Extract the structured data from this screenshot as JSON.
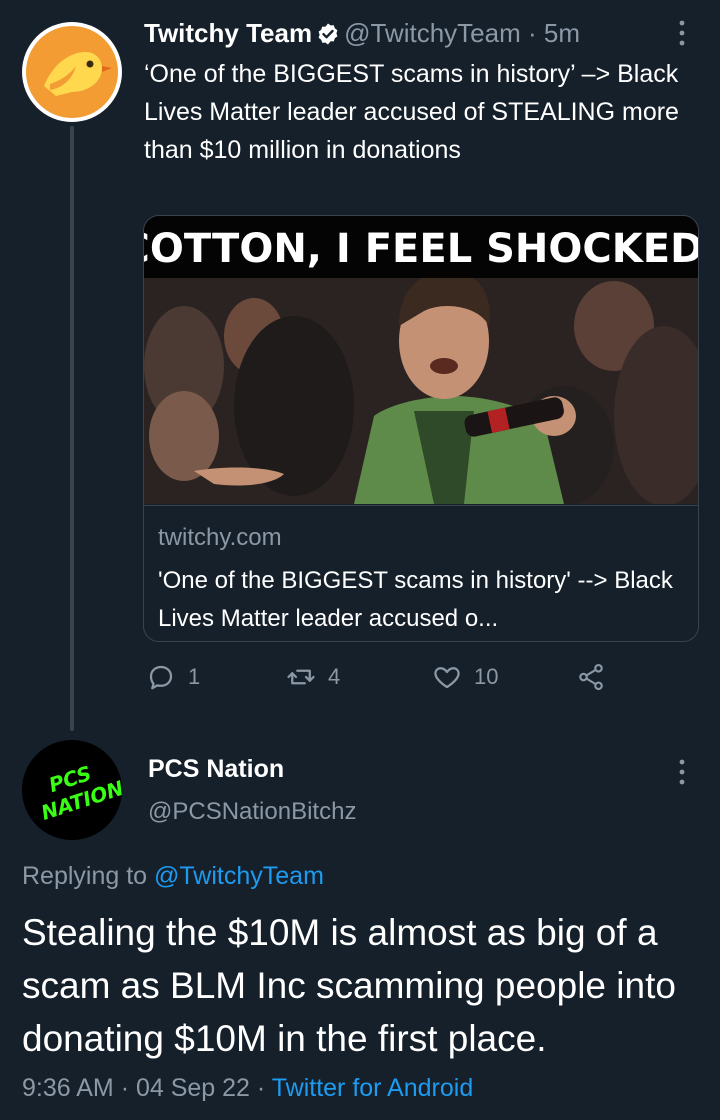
{
  "tweet1": {
    "author_name": "Twitchy Team",
    "handle": "@TwitchyTeam",
    "separator": "·",
    "time": "5m",
    "text": "‘One of the BIGGEST scams in history’ –> Black Lives Matter leader accused of STEALING more than $10 million in donations",
    "card": {
      "image_caption": "COTTON, I FEEL SHOCKED!",
      "domain": "twitchy.com",
      "title": "'One of the BIGGEST scams in history' --> Black Lives Matter leader accused o..."
    },
    "actions": {
      "replies": "1",
      "retweets": "4",
      "likes": "10"
    }
  },
  "tweet2": {
    "avatar_text_line1": "PCS",
    "avatar_text_line2": "NATION",
    "author_name": "PCS Nation",
    "handle": "@PCSNationBitchz",
    "replying_label": "Replying to",
    "replying_to": "@TwitchyTeam",
    "text": "Stealing the $10M is almost as big of a scam as BLM Inc scamming people into donating $10M in the first place.",
    "time": "9:36 AM",
    "sep1": "·",
    "date": "04 Sep 22",
    "sep2": "·",
    "source": "Twitter for Android"
  },
  "colors": {
    "background": "#15202b",
    "text": "#ffffff",
    "muted": "#8b98a5",
    "accent": "#1d9bf0",
    "border": "#38444d",
    "avatar1_bird": "#f39c33",
    "avatar2_text": "#39ff14"
  }
}
